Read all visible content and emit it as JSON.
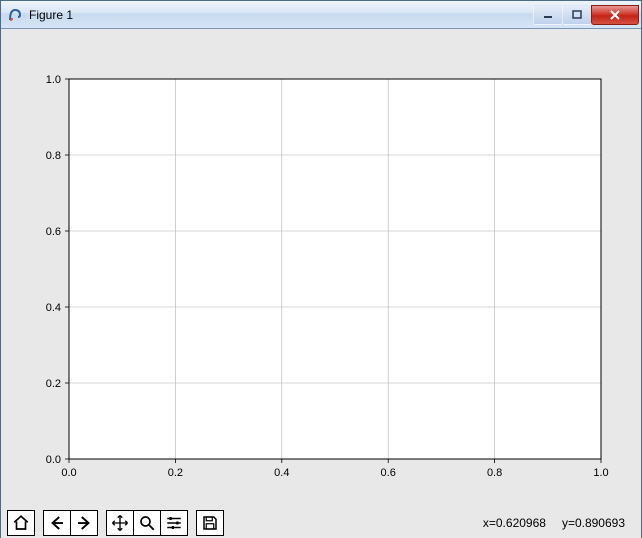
{
  "window": {
    "title": "Figure 1",
    "app_icon_name": "python-tk-icon"
  },
  "chart_data": {
    "type": "line",
    "series": [],
    "title": "",
    "xlabel": "",
    "ylabel": "",
    "xlim": [
      0.0,
      1.0
    ],
    "ylim": [
      0.0,
      1.0
    ],
    "xticks": [
      0.0,
      0.2,
      0.4,
      0.6,
      0.8,
      1.0
    ],
    "yticks": [
      0.0,
      0.2,
      0.4,
      0.6,
      0.8,
      1.0
    ],
    "xtick_labels": [
      "0.0",
      "0.2",
      "0.4",
      "0.6",
      "0.8",
      "1.0"
    ],
    "ytick_labels": [
      "0.0",
      "0.2",
      "0.4",
      "0.6",
      "0.8",
      "1.0"
    ],
    "grid": true
  },
  "toolbar": {
    "home": "Home",
    "back": "Back",
    "forward": "Forward",
    "pan": "Pan",
    "zoom": "Zoom",
    "configure": "Configure subplots",
    "save": "Save"
  },
  "status": {
    "x_label": "x=0.620968",
    "y_label": "y=0.890693"
  },
  "colors": {
    "figure_bg": "#e8e8e8",
    "axes_bg": "#ffffff",
    "spine": "#000000",
    "grid": "#b0b0b0"
  }
}
